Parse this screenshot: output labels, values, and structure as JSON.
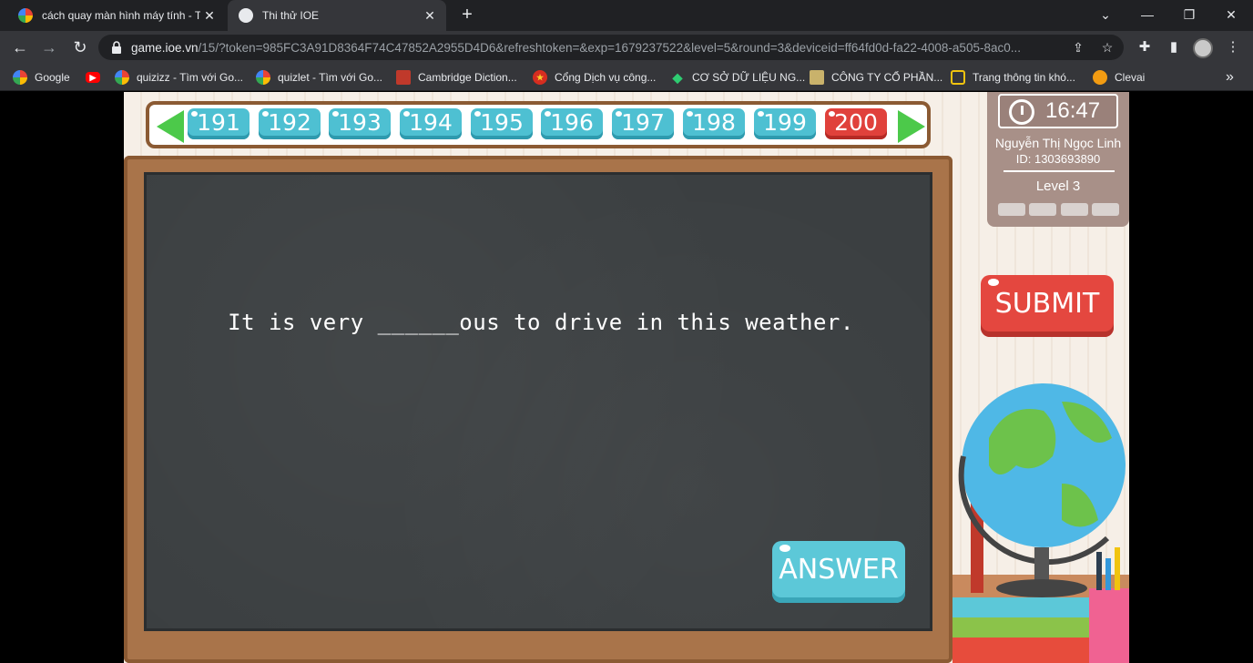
{
  "browser": {
    "tabs": [
      {
        "title": "cách quay màn hình máy tính - Tì",
        "active": false
      },
      {
        "title": "Thi thử IOE",
        "active": true
      }
    ],
    "url_host": "game.ioe.vn",
    "url_rest": "/15/?token=985FC3A91D8364F74C47852A2955D4D6&refreshtoken=&exp=1679237522&level=5&round=3&deviceid=ff64fd0d-fa22-4008-a505-8ac0...",
    "bookmarks": [
      {
        "label": "Google",
        "icon": "google-icon"
      },
      {
        "label": "",
        "icon": "youtube-icon"
      },
      {
        "label": "quizizz - Tìm với Go...",
        "icon": "google-icon"
      },
      {
        "label": "quizlet - Tìm với Go...",
        "icon": "google-icon"
      },
      {
        "label": "Cambridge Diction...",
        "icon": "cambridge-icon"
      },
      {
        "label": "Cổng Dịch vụ công...",
        "icon": "emblem-icon"
      },
      {
        "label": "CƠ SỞ DỮ LIỆU NG...",
        "icon": "diamond-icon"
      },
      {
        "label": "CÔNG TY CỔ PHẦN...",
        "icon": "company-icon"
      },
      {
        "label": "Trang thông tin khó...",
        "icon": "badge-icon"
      },
      {
        "label": "Clevai",
        "icon": "clevai-icon"
      }
    ],
    "bookmarks_overflow": "»"
  },
  "game": {
    "question_numbers": [
      "191",
      "192",
      "193",
      "194",
      "195",
      "196",
      "197",
      "198",
      "199",
      "200"
    ],
    "active_question": "200",
    "question_text": "It is very ______ous to drive in this weather.",
    "answer_label": "ANSWER",
    "submit_label": "SUBMIT",
    "timer": "16:47",
    "user_name": "Nguyễn Thị Ngọc  Linh",
    "user_id": "ID: 1303693890",
    "level": "Level 3"
  },
  "colors": {
    "active_question": "#e0413b",
    "question_button": "#4ec0d2",
    "submit": "#e4473f",
    "answer": "#5cc8d8",
    "board": "#3b3f41"
  }
}
